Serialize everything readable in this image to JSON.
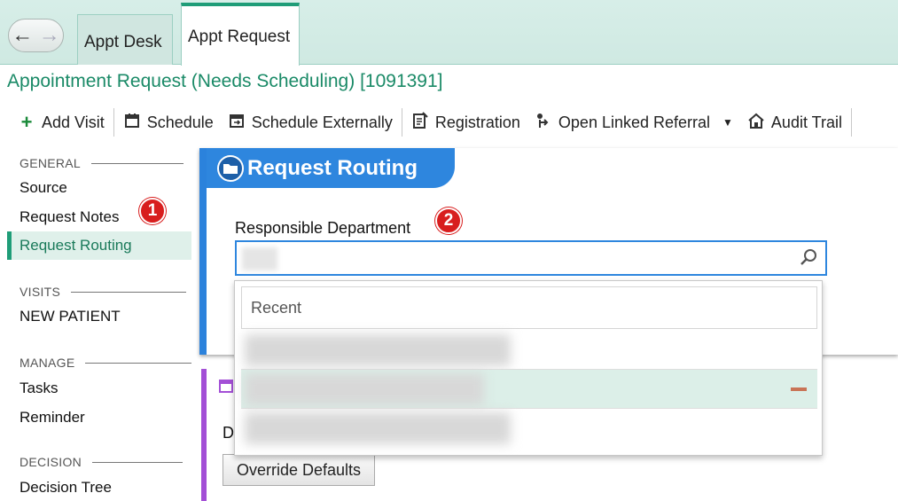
{
  "nav": {
    "back_icon": "←",
    "forward_icon": "→"
  },
  "tabs": [
    {
      "label": "Appt Desk"
    },
    {
      "label": "Appt Request"
    }
  ],
  "page_title": "Appointment Request (Needs Scheduling) [1091391]",
  "toolbar": {
    "add_visit": "Add Visit",
    "schedule": "Schedule",
    "schedule_externally": "Schedule Externally",
    "registration": "Registration",
    "open_linked_referral": "Open Linked Referral",
    "audit_trail": "Audit Trail"
  },
  "sidebar": {
    "general": "GENERAL",
    "source": "Source",
    "request_notes": "Request Notes",
    "request_routing": "Request Routing",
    "visits": "VISITS",
    "new_patient": "NEW PATIENT",
    "manage": "MANAGE",
    "tasks": "Tasks",
    "reminder": "Reminder",
    "decision": "DECISION",
    "decision_tree": "Decision Tree"
  },
  "badges": {
    "one": "1",
    "two": "2"
  },
  "routing": {
    "header": "Request Routing",
    "field_label": "Responsible Department",
    "dropdown_header": "Recent"
  },
  "lower": {
    "label_partial": "De",
    "override_button": "Override Defaults"
  },
  "colors": {
    "accent_green": "#1f9d78",
    "blue": "#2e86de",
    "purple": "#a34fd6",
    "badge_red": "#d81e1e"
  }
}
